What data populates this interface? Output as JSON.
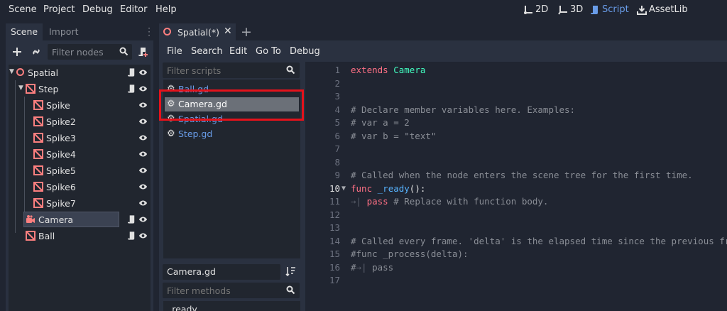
{
  "menubar": {
    "items": [
      "Scene",
      "Project",
      "Debug",
      "Editor",
      "Help"
    ],
    "workspaces": [
      {
        "label": "2D",
        "icon": "2d-icon",
        "active": false
      },
      {
        "label": "3D",
        "icon": "3d-icon",
        "active": false
      },
      {
        "label": "Script",
        "icon": "script-icon",
        "active": true
      },
      {
        "label": "AssetLib",
        "icon": "assetlib-icon",
        "active": false
      }
    ]
  },
  "scene_dock": {
    "tabs": [
      "Scene",
      "Import"
    ],
    "active_tab": "Scene",
    "filter_placeholder": "Filter nodes",
    "nodes": [
      {
        "label": "Spatial",
        "icon": "spatial-icon",
        "script": true,
        "visible": true
      },
      {
        "label": "Step",
        "icon": "static-body-icon",
        "script": true,
        "visible": true
      },
      {
        "label": "Spike",
        "icon": "static-body-icon",
        "script": false,
        "visible": true
      },
      {
        "label": "Spike2",
        "icon": "static-body-icon",
        "script": false,
        "visible": true
      },
      {
        "label": "Spike3",
        "icon": "static-body-icon",
        "script": false,
        "visible": true
      },
      {
        "label": "Spike4",
        "icon": "static-body-icon",
        "script": false,
        "visible": true
      },
      {
        "label": "Spike5",
        "icon": "static-body-icon",
        "script": false,
        "visible": true
      },
      {
        "label": "Spike6",
        "icon": "static-body-icon",
        "script": false,
        "visible": true
      },
      {
        "label": "Spike7",
        "icon": "static-body-icon",
        "script": false,
        "visible": true
      },
      {
        "label": "Camera",
        "icon": "camera-icon",
        "script": true,
        "visible": true,
        "selected": true
      },
      {
        "label": "Ball",
        "icon": "static-body-icon",
        "script": true,
        "visible": true
      }
    ]
  },
  "editor": {
    "tab_label": "Spatial(*)",
    "menu": [
      "File",
      "Search",
      "Edit",
      "Go To",
      "Debug"
    ],
    "script_filter_placeholder": "Filter scripts",
    "scripts": [
      "Ball.gd",
      "Camera.gd",
      "Spatial.gd",
      "Step.gd"
    ],
    "selected_script": "Camera.gd",
    "current_script_name": "Camera.gd",
    "method_filter_placeholder": "Filter methods",
    "methods": [
      "_ready"
    ],
    "current_line": 10
  },
  "code_lines": [
    {
      "n": "1",
      "parts": [
        [
          "kw",
          "extends"
        ],
        [
          "tx",
          " "
        ],
        [
          "ty",
          "Camera"
        ]
      ]
    },
    {
      "n": "2",
      "parts": []
    },
    {
      "n": "3",
      "parts": []
    },
    {
      "n": "4",
      "parts": [
        [
          "cm",
          "# Declare member variables here. Examples:"
        ]
      ]
    },
    {
      "n": "5",
      "parts": [
        [
          "cm",
          "# var a = 2"
        ]
      ]
    },
    {
      "n": "6",
      "parts": [
        [
          "cm",
          "# var b = \"text\""
        ]
      ]
    },
    {
      "n": "7",
      "parts": []
    },
    {
      "n": "8",
      "parts": []
    },
    {
      "n": "9",
      "parts": [
        [
          "cm",
          "# Called when the node enters the scene tree for the first time."
        ]
      ]
    },
    {
      "n": "10",
      "parts": [
        [
          "kw",
          "func"
        ],
        [
          "tx",
          " "
        ],
        [
          "fn",
          "_ready"
        ],
        [
          "tx",
          "():"
        ]
      ]
    },
    {
      "n": "11",
      "parts": [
        [
          "tabmark",
          "→| "
        ],
        [
          "kw",
          "pass"
        ],
        [
          "tx",
          " "
        ],
        [
          "cm",
          "# Replace with function body."
        ]
      ]
    },
    {
      "n": "12",
      "parts": []
    },
    {
      "n": "13",
      "parts": []
    },
    {
      "n": "14",
      "parts": [
        [
          "cm",
          "# Called every frame. 'delta' is the elapsed time since the previous frame."
        ]
      ]
    },
    {
      "n": "15",
      "parts": [
        [
          "cm",
          "#func _process(delta):"
        ]
      ]
    },
    {
      "n": "16",
      "parts": [
        [
          "cm",
          "#"
        ],
        [
          "tabmark",
          "→| "
        ],
        [
          "cm",
          "pass"
        ]
      ]
    },
    {
      "n": "17",
      "parts": []
    }
  ],
  "colors": {
    "accent": "#699ce8",
    "highlight_box": "#e5121b",
    "keyword": "#ff7085",
    "type": "#42ffc2",
    "function": "#57b3ff",
    "comment": "#8a8e96"
  }
}
